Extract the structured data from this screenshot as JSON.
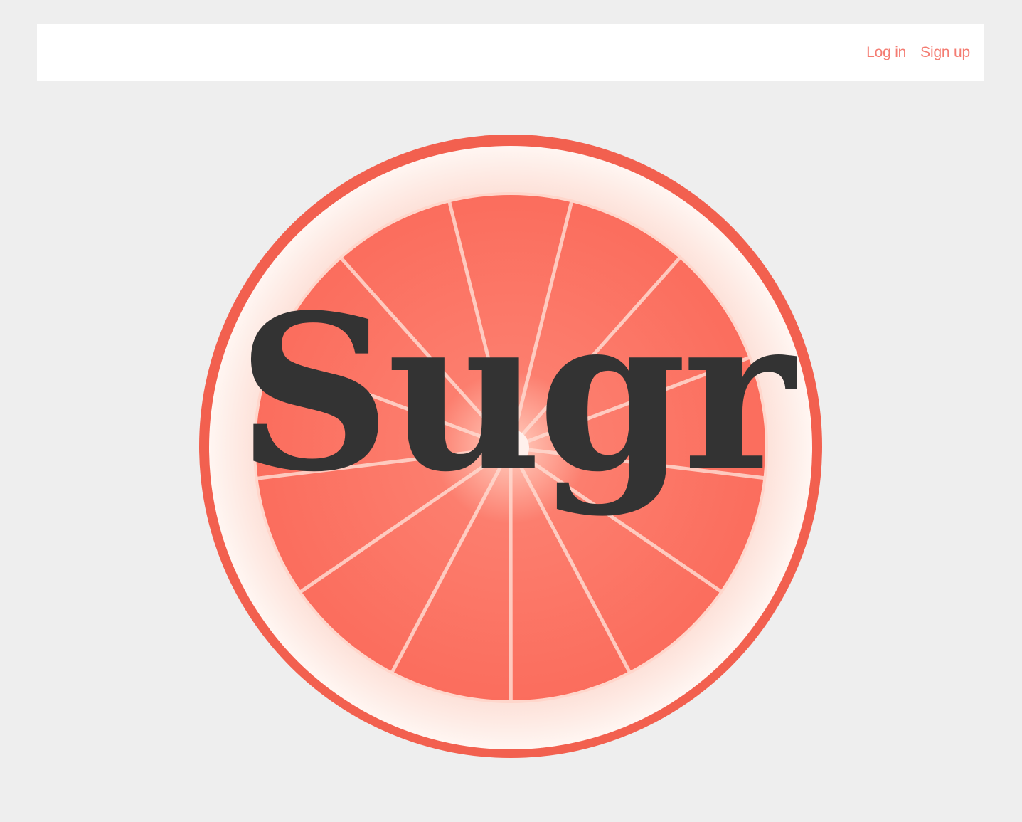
{
  "nav": {
    "login_label": "Log in",
    "signup_label": "Sign up"
  },
  "hero": {
    "title": "Sugr",
    "image": "grapefruit-slice"
  },
  "colors": {
    "background": "#eeeeee",
    "navbar": "#ffffff",
    "link": "#f47c72",
    "title": "#333333",
    "rind": "#f2604f",
    "pith": "#fdeee9",
    "flesh": "#fb7162"
  }
}
